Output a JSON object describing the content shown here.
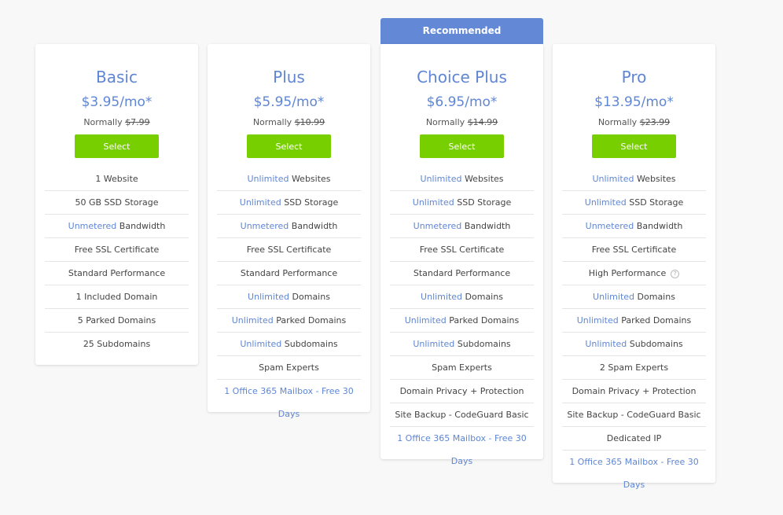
{
  "recommended_label": "Recommended",
  "select_label": "Select",
  "normally_label": "Normally",
  "plans": [
    {
      "name": "Basic",
      "price": "$3.95/mo*",
      "normal_price": "$7.99",
      "features": [
        {
          "hl": "",
          "text": "1 Website"
        },
        {
          "hl": "",
          "text": "50 GB SSD Storage"
        },
        {
          "hl": "Unmetered",
          "text": " Bandwidth"
        },
        {
          "hl": "",
          "text": "Free SSL Certificate"
        },
        {
          "hl": "",
          "text": "Standard Performance"
        },
        {
          "hl": "",
          "text": "1 Included Domain"
        },
        {
          "hl": "",
          "text": "5 Parked Domains"
        },
        {
          "hl": "",
          "text": "25 Subdomains"
        }
      ]
    },
    {
      "name": "Plus",
      "price": "$5.95/mo*",
      "normal_price": "$10.99",
      "features": [
        {
          "hl": "Unlimited",
          "text": " Websites"
        },
        {
          "hl": "Unlimited",
          "text": " SSD Storage"
        },
        {
          "hl": "Unmetered",
          "text": " Bandwidth"
        },
        {
          "hl": "",
          "text": "Free SSL Certificate"
        },
        {
          "hl": "",
          "text": "Standard Performance"
        },
        {
          "hl": "Unlimited",
          "text": " Domains"
        },
        {
          "hl": "Unlimited",
          "text": " Parked Domains"
        },
        {
          "hl": "Unlimited",
          "text": " Subdomains"
        },
        {
          "hl": "",
          "text": "Spam Experts"
        },
        {
          "hl": "1 Office 365 Mailbox - Free 30 Days",
          "text": "",
          "link": true
        }
      ]
    },
    {
      "name": "Choice Plus",
      "price": "$6.95/mo*",
      "normal_price": "$14.99",
      "features": [
        {
          "hl": "Unlimited",
          "text": " Websites"
        },
        {
          "hl": "Unlimited",
          "text": " SSD Storage"
        },
        {
          "hl": "Unmetered",
          "text": " Bandwidth"
        },
        {
          "hl": "",
          "text": "Free SSL Certificate"
        },
        {
          "hl": "",
          "text": "Standard Performance"
        },
        {
          "hl": "Unlimited",
          "text": " Domains"
        },
        {
          "hl": "Unlimited",
          "text": " Parked Domains"
        },
        {
          "hl": "Unlimited",
          "text": " Subdomains"
        },
        {
          "hl": "",
          "text": "Spam Experts"
        },
        {
          "hl": "",
          "text": "Domain Privacy + Protection"
        },
        {
          "hl": "",
          "text": "Site Backup - CodeGuard Basic"
        },
        {
          "hl": "1 Office 365 Mailbox - Free 30 Days",
          "text": "",
          "link": true
        }
      ]
    },
    {
      "name": "Pro",
      "price": "$13.95/mo*",
      "normal_price": "$23.99",
      "features": [
        {
          "hl": "Unlimited",
          "text": " Websites"
        },
        {
          "hl": "Unlimited",
          "text": " SSD Storage"
        },
        {
          "hl": "Unmetered",
          "text": " Bandwidth"
        },
        {
          "hl": "",
          "text": "Free SSL Certificate"
        },
        {
          "hl": "",
          "text": "High Performance",
          "help": "?"
        },
        {
          "hl": "Unlimited",
          "text": " Domains"
        },
        {
          "hl": "Unlimited",
          "text": " Parked Domains"
        },
        {
          "hl": "Unlimited",
          "text": " Subdomains"
        },
        {
          "hl": "",
          "text": "2 Spam Experts"
        },
        {
          "hl": "",
          "text": "Domain Privacy + Protection"
        },
        {
          "hl": "",
          "text": "Site Backup - CodeGuard Basic"
        },
        {
          "hl": "",
          "text": "Dedicated IP"
        },
        {
          "hl": "1 Office 365 Mailbox - Free 30 Days",
          "text": "",
          "link": true
        }
      ]
    }
  ]
}
